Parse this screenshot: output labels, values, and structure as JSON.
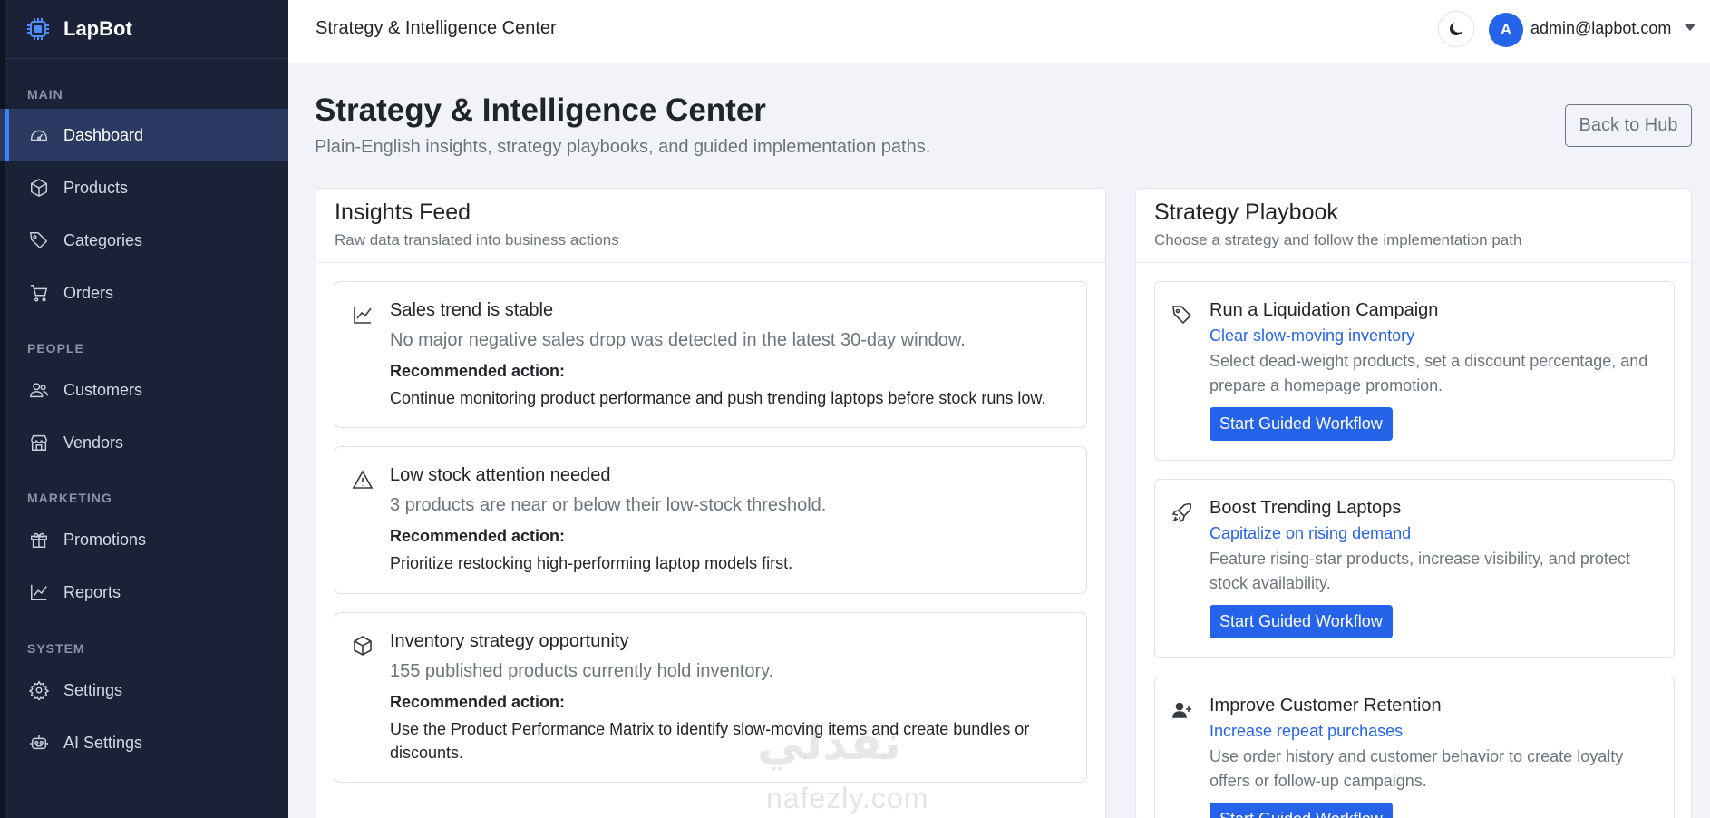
{
  "app": {
    "name": "LapBot"
  },
  "sidebar": {
    "sections": [
      {
        "label": "MAIN"
      },
      {
        "label": "PEOPLE"
      },
      {
        "label": "MARKETING"
      },
      {
        "label": "SYSTEM"
      }
    ],
    "items": [
      {
        "label": "Dashboard",
        "icon": "gauge-icon",
        "active": true
      },
      {
        "label": "Products",
        "icon": "box-icon"
      },
      {
        "label": "Categories",
        "icon": "tags-icon"
      },
      {
        "label": "Orders",
        "icon": "cart-icon"
      },
      {
        "label": "Customers",
        "icon": "people-icon"
      },
      {
        "label": "Vendors",
        "icon": "shop-icon"
      },
      {
        "label": "Promotions",
        "icon": "gift-icon"
      },
      {
        "label": "Reports",
        "icon": "graph-up-icon"
      },
      {
        "label": "Settings",
        "icon": "gear-icon"
      },
      {
        "label": "AI Settings",
        "icon": "robot-icon"
      }
    ]
  },
  "topbar": {
    "title": "Strategy & Intelligence Center",
    "avatar_initial": "A",
    "user_email": "admin@lapbot.com"
  },
  "page": {
    "title": "Strategy & Intelligence Center",
    "subtitle": "Plain-English insights, strategy playbooks, and guided implementation paths.",
    "back_label": "Back to Hub"
  },
  "insights": {
    "title": "Insights Feed",
    "subtitle": "Raw data translated into business actions",
    "rec_label": "Recommended action:",
    "cards": [
      {
        "icon": "graph-up-icon",
        "title": "Sales trend is stable",
        "desc": "No major negative sales drop was detected in the latest 30-day window.",
        "rec": "Continue monitoring product performance and push trending laptops before stock runs low."
      },
      {
        "icon": "warning-icon",
        "title": "Low stock attention needed",
        "desc": "3 products are near or below their low-stock threshold.",
        "rec": "Prioritize restocking high-performing laptop models first."
      },
      {
        "icon": "box-icon",
        "title": "Inventory strategy opportunity",
        "desc": "155 published products currently hold inventory.",
        "rec": "Use the Product Performance Matrix to identify slow-moving items and create bundles or discounts."
      }
    ]
  },
  "playbook": {
    "title": "Strategy Playbook",
    "subtitle": "Choose a strategy and follow the implementation path",
    "button_label": "Start Guided Workflow",
    "cards": [
      {
        "icon": "tags-icon",
        "title": "Run a Liquidation Campaign",
        "subtitle": "Clear slow-moving inventory",
        "desc": "Select dead-weight products, set a discount percentage, and prepare a homepage promotion."
      },
      {
        "icon": "rocket-icon",
        "title": "Boost Trending Laptops",
        "subtitle": "Capitalize on rising demand",
        "desc": "Feature rising-star products, increase visibility, and protect stock availability."
      },
      {
        "icon": "person-plus-icon",
        "title": "Improve Customer Retention",
        "subtitle": "Increase repeat purchases",
        "desc": "Use order history and customer behavior to create loyalty offers or follow-up campaigns."
      }
    ]
  },
  "watermark": {
    "text": "نفذلي",
    "url": "nafezly.com"
  }
}
